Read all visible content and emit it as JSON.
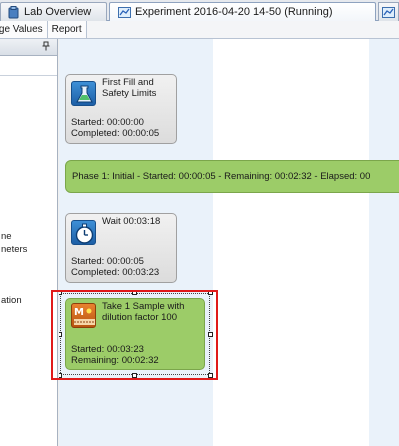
{
  "tabs": {
    "lab_overview": "Lab Overview",
    "experiment": "Experiment 2016-04-20 14-50 (Running)"
  },
  "toolbar": {
    "charge_values": "arge Values",
    "report": "Report"
  },
  "left_panel": {
    "item1": "ne",
    "item2": "neters",
    "item3": "ation"
  },
  "steps": [
    {
      "title": "First Fill and Safety Limits",
      "started": "Started: 00:00:00",
      "completed": "Completed: 00:00:05"
    },
    {
      "title": "Wait 00:03:18",
      "started": "Started: 00:00:05",
      "completed": "Completed: 00:03:23"
    },
    {
      "title": "Take 1 Sample with dilution factor 100",
      "started": "Started: 00:03:23",
      "remaining": "Remaining: 00:02:32"
    }
  ],
  "phase": {
    "text": "Phase 1: Initial - Started: 00:00:05 - Remaining: 00:02:32 - Elapsed: 00"
  },
  "colors": {
    "phase_green": "#9ccc68",
    "selection_red": "#e01a1a",
    "lane_blue": "#eaf2fa"
  },
  "icons": [
    "lab-overview-icon",
    "experiment-icon",
    "pin-icon",
    "flask-icon",
    "stopwatch-icon",
    "sample-icon"
  ]
}
